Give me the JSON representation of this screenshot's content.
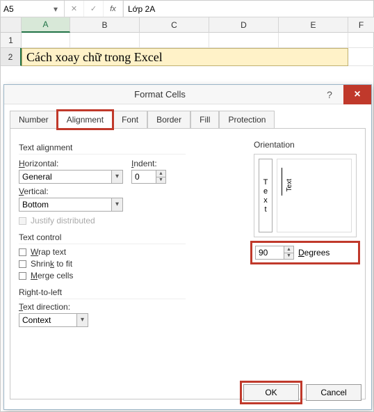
{
  "formula_bar": {
    "name_box": "A5",
    "cancel_glyph": "✕",
    "enter_glyph": "✓",
    "fx_glyph": "fx",
    "formula_value": "Lớp 2A"
  },
  "columns": {
    "A": "A",
    "B": "B",
    "C": "C",
    "D": "D",
    "E": "E",
    "F": "F"
  },
  "rows": {
    "r1": "1",
    "r2": "2"
  },
  "cell_b2_merged": "Cách xoay chữ trong Excel",
  "dialog": {
    "title": "Format Cells",
    "help": "?",
    "close": "×",
    "tabs": {
      "number": "Number",
      "alignment": "Alignment",
      "font": "Font",
      "border": "Border",
      "fill": "Fill",
      "protection": "Protection"
    },
    "text_alignment": {
      "legend": "Text alignment",
      "horizontal_label": "Horizontal:",
      "horizontal_value": "General",
      "indent_label": "Indent:",
      "indent_value": "0",
      "vertical_label": "Vertical:",
      "vertical_value": "Bottom",
      "justify_label": "Justify distributed"
    },
    "text_control": {
      "legend": "Text control",
      "wrap": "Wrap text",
      "shrink": "Shrink to fit",
      "merge": "Merge cells"
    },
    "rtl": {
      "legend": "Right-to-left",
      "dir_label": "Text direction:",
      "dir_value": "Context"
    },
    "orientation": {
      "legend": "Orientation",
      "vertical_word_chars": [
        "T",
        "e",
        "x",
        "t"
      ],
      "dial_label": "Text",
      "degrees_value": "90",
      "degrees_label": "Degrees"
    },
    "buttons": {
      "ok": "OK",
      "cancel": "Cancel"
    }
  }
}
